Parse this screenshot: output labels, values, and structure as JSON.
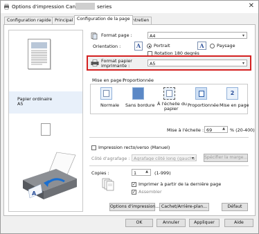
{
  "window": {
    "title_prefix": "Options d'impression Canon",
    "title_suffix": "series"
  },
  "tabs": [
    {
      "label": "Configuration rapide"
    },
    {
      "label": "Principal"
    },
    {
      "label": "Configuration de la page"
    },
    {
      "label": "Entretien"
    }
  ],
  "preview": {
    "paper_type": "Papier ordinaire",
    "paper_size": "A5"
  },
  "page_format": {
    "label": "Format page :",
    "value": "A4"
  },
  "orientation": {
    "label": "Orientation :",
    "portrait": "Portrait",
    "landscape": "Paysage",
    "rotate_label": "Rotation 180 degrés",
    "selected": "Portrait"
  },
  "printer_paper": {
    "label_line1": "Format papier",
    "label_line2": "imprimante :",
    "value": "A5",
    "highlight_color": "#d42020"
  },
  "page_layout": {
    "label": "Mise en page :",
    "current": "Proportionnée",
    "options": [
      {
        "label": "Normale"
      },
      {
        "label": "Sans bordure"
      },
      {
        "label_line1": "À l'échelle du",
        "label_line2": "papier"
      },
      {
        "label": "Proportionnée"
      },
      {
        "label": "Mise en page"
      }
    ],
    "selected_index": 3,
    "tile_badge": "2"
  },
  "scale": {
    "label": "Mise à l'échelle :",
    "value": "69",
    "range": "% (20-400)"
  },
  "duplex": {
    "label": "Impression recto/verso (Manuel)",
    "checked": false,
    "stapling_label": "Côté d'agrafage :",
    "stapling_value": "Agrafage côté long (gauche)",
    "margin_button": "Spécifier la marge..."
  },
  "copies": {
    "label": "Copies :",
    "value": "1",
    "range": "(1-999)",
    "print_from_last": "Imprimer à partir de la dernière page",
    "print_from_last_checked": true,
    "collate": "Assembler",
    "collate_checked": true
  },
  "bottom_buttons": {
    "print_options": "Options d'impression...",
    "stamp_background": "Cachet/Arrière-plan...",
    "defaults": "Défaut"
  },
  "dialog_buttons": {
    "ok": "OK",
    "cancel": "Annuler",
    "apply": "Appliquer",
    "help": "Aide"
  }
}
